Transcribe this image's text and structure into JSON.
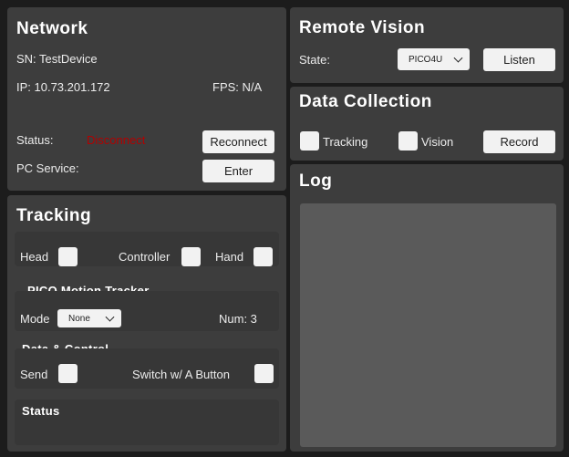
{
  "network": {
    "title": "Network",
    "sn": "SN: TestDevice",
    "ip": "IP: 10.73.201.172",
    "fps": "FPS: N/A",
    "status_label": "Status:",
    "status_value": "Disconnect",
    "reconnect_label": "Reconnect",
    "pc_service_label": "PC Service:",
    "enter_label": "Enter"
  },
  "tracking": {
    "title": "Tracking",
    "head_label": "Head",
    "controller_label": "Controller",
    "hand_label": "Hand",
    "motion_tracker_title": "PICO Motion Tracker",
    "mode_label": "Mode",
    "mode_value": "None",
    "num_label": "Num: 3",
    "data_control_title": "Data & Control",
    "send_label": "Send",
    "switch_label": "Switch w/ A Button",
    "status_title": "Status"
  },
  "remote_vision": {
    "title": "Remote Vision",
    "state_label": "State:",
    "state_value": "PICO4U",
    "listen_label": "Listen"
  },
  "data_collection": {
    "title": "Data Collection",
    "tracking_label": "Tracking",
    "vision_label": "Vision",
    "record_label": "Record"
  },
  "log": {
    "title": "Log"
  },
  "colors": {
    "background": "#1c1c1c",
    "panel": "#3d3d3d",
    "subpanel": "#373737",
    "status_disconnect": "#b30000",
    "button": "#f2f2f2"
  }
}
